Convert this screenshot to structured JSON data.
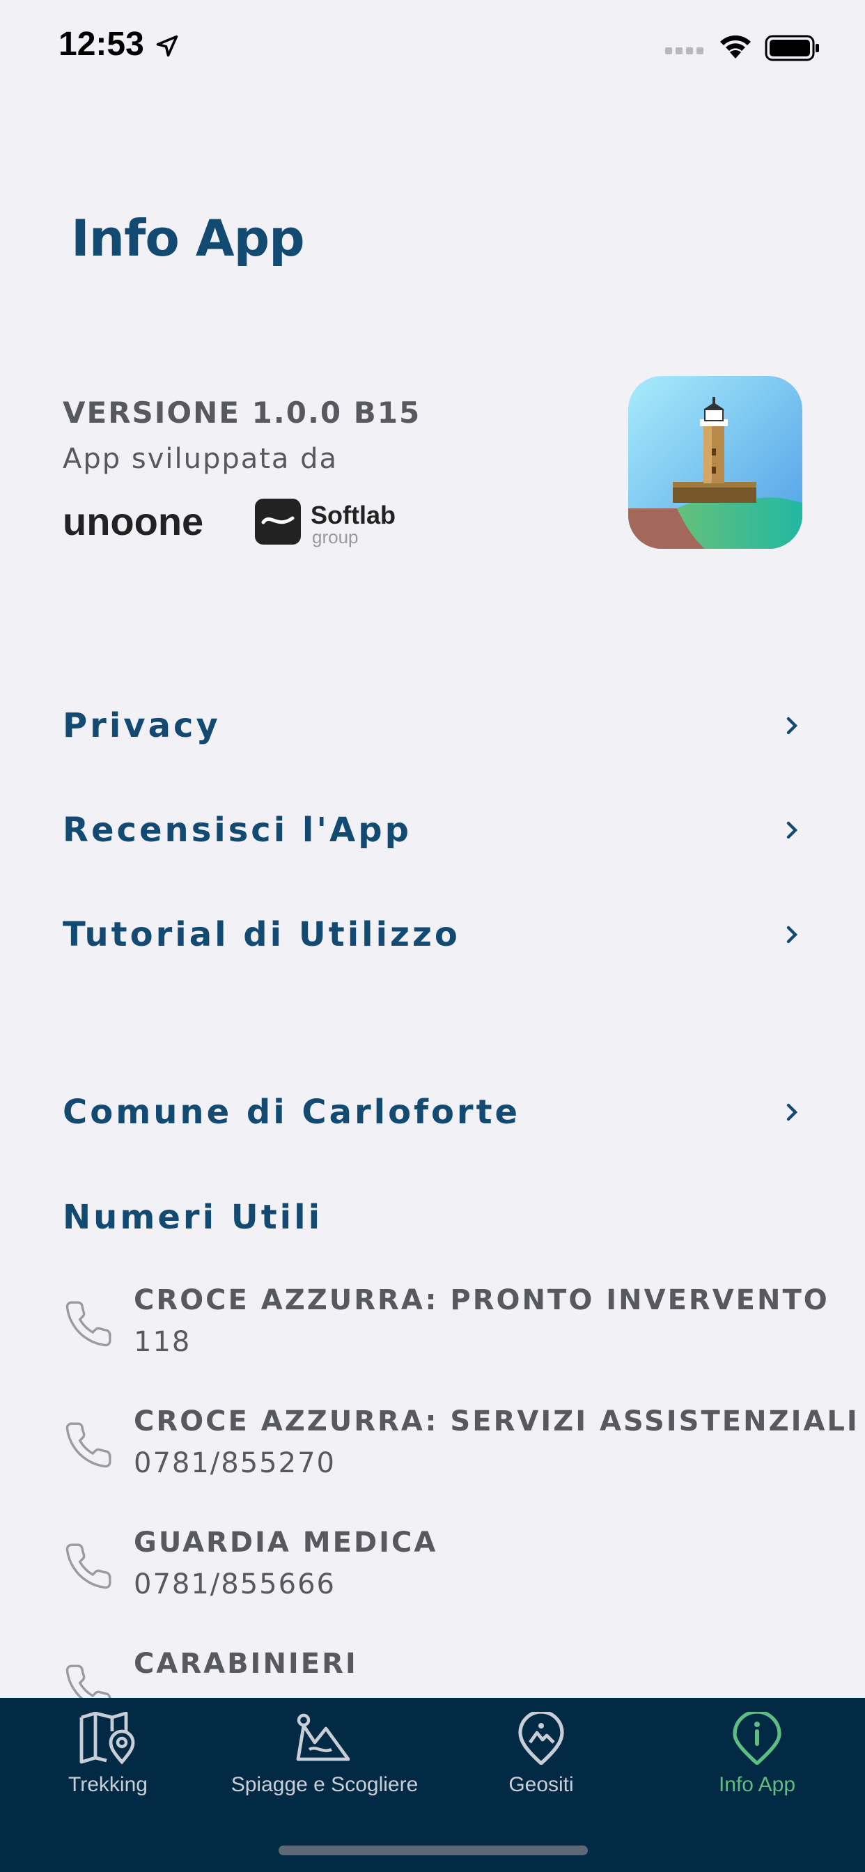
{
  "status": {
    "time": "12:53"
  },
  "page": {
    "title": "Info App"
  },
  "about": {
    "version": "VERSIONE 1.0.0 B15",
    "developed_by": "App sviluppata da",
    "dev_logo_1": "unoone",
    "dev_logo_2_main": "Softlab",
    "dev_logo_2_sub": "group"
  },
  "menu": [
    {
      "label": "Privacy"
    },
    {
      "label": "Recensisci l'App"
    },
    {
      "label": "Tutorial di Utilizzo"
    },
    {
      "label": "Comune di Carloforte"
    }
  ],
  "numbers": {
    "title": "Numeri Utili",
    "items": [
      {
        "name": "CROCE AZZURRA: PRONTO INVERVENTO",
        "number": "118"
      },
      {
        "name": "CROCE AZZURRA: SERVIZI ASSISTENZIALI",
        "number": "0781/855270"
      },
      {
        "name": "GUARDIA MEDICA",
        "number": "0781/855666"
      },
      {
        "name": "CARABINIERI",
        "number": ""
      }
    ]
  },
  "tabbar": {
    "tabs": [
      {
        "label": "Trekking",
        "icon": "map-pin-icon"
      },
      {
        "label": "Spiagge e Scogliere",
        "icon": "beach-icon"
      },
      {
        "label": "Geositi",
        "icon": "location-mountain-icon"
      },
      {
        "label": "Info App",
        "icon": "info-icon"
      }
    ],
    "active_color": "#5fbd82",
    "bg_color": "#022a44"
  },
  "colors": {
    "accent": "#134a72",
    "text_gray": "#58595f",
    "background": "#f2f2f6"
  }
}
